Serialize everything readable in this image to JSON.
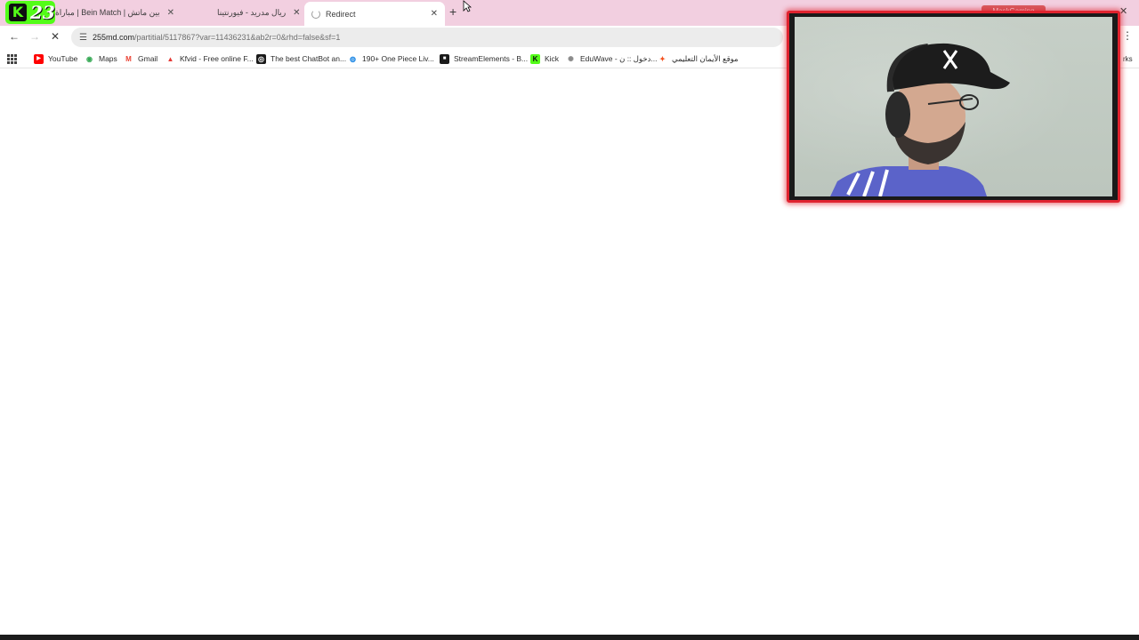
{
  "browser": {
    "stream_badge": {
      "letter": "K",
      "number": "23"
    },
    "tabs": [
      {
        "title": "بين ماتش | Bein Match | مباراة",
        "close": "✕"
      },
      {
        "title": "ريال مدريد - فيورنتينا",
        "close": "✕"
      },
      {
        "title": "Redirect",
        "close": "✕",
        "active": true,
        "loading": true
      }
    ],
    "new_tab": "+",
    "window_close": "✕",
    "toolbar": {
      "back": "←",
      "forward": "→",
      "stop": "✕",
      "url_host": "255md.com",
      "url_path": "/partitial/5117867?var=11436231&ab2r=0&rhd=false&sf=1",
      "menu": "⋮"
    },
    "bookmarks": [
      {
        "label": "YouTube",
        "icon": "youtube-icon",
        "color": "#ff0000",
        "glyph": "▶"
      },
      {
        "label": "Maps",
        "icon": "maps-icon",
        "color": "#34a853",
        "glyph": "◉"
      },
      {
        "label": "Gmail",
        "icon": "gmail-icon",
        "color": "#ea4335",
        "glyph": "M"
      },
      {
        "label": "Kfvid - Free online F...",
        "icon": "kfvid-icon",
        "color": "#e53935",
        "glyph": "▲"
      },
      {
        "label": "The best ChatBot an...",
        "icon": "chatbot-icon",
        "color": "#1a1a1a",
        "glyph": "◎"
      },
      {
        "label": "190+ One Piece Liv...",
        "icon": "onepiece-icon",
        "color": "#1e88e5",
        "glyph": "◍"
      },
      {
        "label": "StreamElements - B...",
        "icon": "streamelements-icon",
        "color": "#1a1a1a",
        "glyph": "■"
      },
      {
        "label": "Kick",
        "icon": "kick-icon",
        "color": "#53fc18",
        "glyph": "K"
      },
      {
        "label": "EduWave - دخول :: ن...",
        "icon": "eduwave-icon",
        "color": "#8a8a8a",
        "glyph": "✺"
      },
      {
        "label": "موقع الأيمان التعليمي",
        "icon": "alaiman-icon",
        "color": "#f4511e",
        "glyph": "✦"
      }
    ],
    "bookmarks_overflow": "rks"
  },
  "overlay": {
    "label": "MaskGaming"
  },
  "colors": {
    "tabstrip": "#f2cfe0",
    "webcam_border": "#e0232f",
    "kick_green": "#53fc18"
  }
}
